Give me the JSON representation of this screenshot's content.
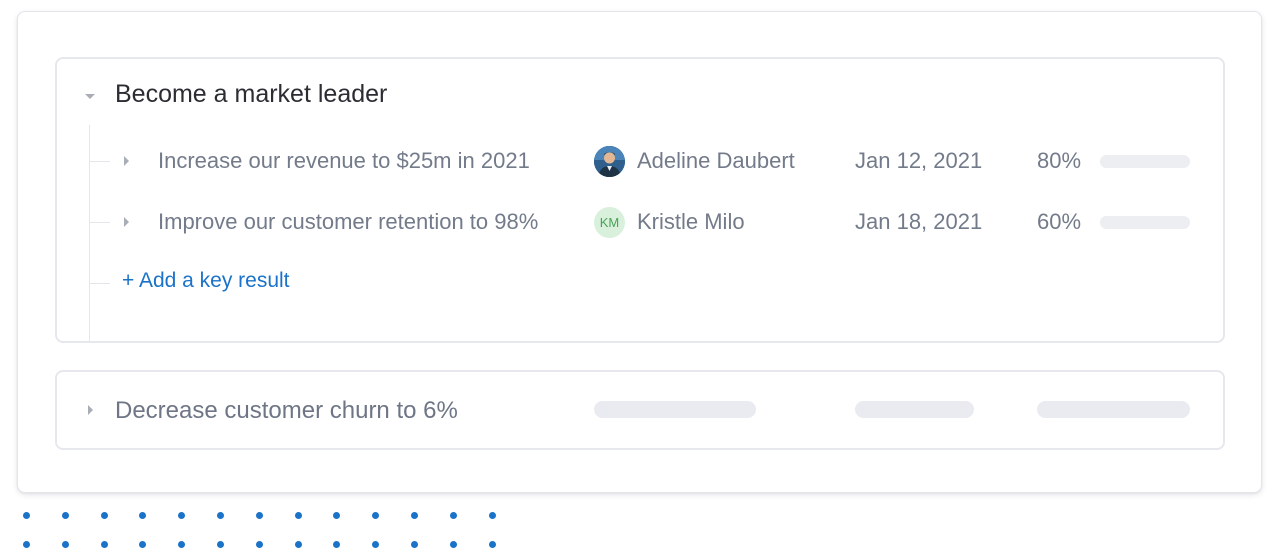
{
  "objectives": [
    {
      "title": "Become a market leader",
      "expanded": true,
      "key_results": [
        {
          "title": "Increase our revenue to $25m in 2021",
          "owner": "Adeline Daubert",
          "avatar_type": "photo",
          "date": "Jan 12, 2021",
          "progress_label": "80%",
          "progress": 0.8
        },
        {
          "title": "Improve our customer retention to 98%",
          "owner": "Kristle Milo",
          "avatar_type": "initials",
          "initials": "KM",
          "date": "Jan 18, 2021",
          "progress_label": "60%",
          "progress": 0.6
        }
      ],
      "add_label": "+ Add a key result"
    },
    {
      "title": "Decrease customer churn to 6%",
      "expanded": false
    }
  ],
  "colors": {
    "accent": "#1a73c8",
    "text_dark": "#2b2d33",
    "text_muted": "#737b8a",
    "skeleton": "#e9ebf0",
    "avatar_initials_bg": "#d9f1dc",
    "avatar_initials_fg": "#49a257"
  },
  "icons": {
    "expand": "caret-down-icon",
    "collapse": "caret-right-icon"
  }
}
